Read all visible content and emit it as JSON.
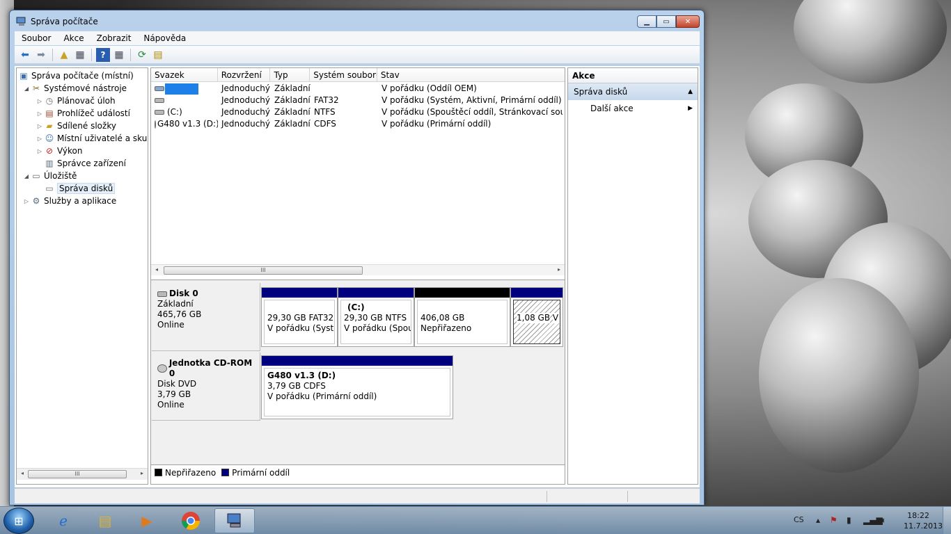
{
  "window": {
    "title": "Správa počítače"
  },
  "menu": [
    "Soubor",
    "Akce",
    "Zobrazit",
    "Nápověda"
  ],
  "tree": {
    "root": "Správa počítače (místní)",
    "system_tools": "Systémové nástroje",
    "items": [
      "Plánovač úloh",
      "Prohlížeč událostí",
      "Sdílené složky",
      "Místní uživatelé a skupiny",
      "Výkon",
      "Správce zařízení"
    ],
    "storage": "Úložiště",
    "disk_management": "Správa disků",
    "services": "Služby a aplikace"
  },
  "volumes": {
    "headers": [
      "Svazek",
      "Rozvržení",
      "Typ",
      "Systém souborů",
      "Stav"
    ],
    "rows": [
      [
        "",
        "Jednoduchý",
        "Základní",
        "",
        "V pořádku (Oddíl OEM)"
      ],
      [
        "",
        "Jednoduchý",
        "Základní",
        "FAT32",
        "V pořádku (Systém, Aktivní, Primární oddíl)"
      ],
      [
        "(C:)",
        "Jednoduchý",
        "Základní",
        "NTFS",
        "V pořádku (Spouštěcí oddíl, Stránkovací soubor, S"
      ],
      [
        "G480 v1.3 (D:)",
        "Jednoduchý",
        "Základní",
        "CDFS",
        "V pořádku (Primární oddíl)"
      ]
    ],
    "scroll_thumb": "III"
  },
  "disk0": {
    "name": "Disk 0",
    "type": "Základní",
    "size": "465,76 GB",
    "status": "Online",
    "partitions": [
      {
        "title": "",
        "size": "29,30 GB FAT32",
        "status": "V pořádku (Systém"
      },
      {
        "title": "(C:)",
        "size": "29,30 GB NTFS",
        "status": "V pořádku (Spouš"
      },
      {
        "title": "",
        "size": "406,08 GB",
        "status": "Nepřiřazeno"
      },
      {
        "title": "",
        "size": "1,08 GB",
        "status": "V pořádku ("
      }
    ]
  },
  "cdrom0": {
    "name": "Jednotka CD-ROM 0",
    "type": "Disk DVD",
    "size": "3,79 GB",
    "status": "Online",
    "partition": {
      "title": "G480 v1.3  (D:)",
      "size": "3,79 GB CDFS",
      "status": "V pořádku (Primární oddíl)"
    }
  },
  "legend": {
    "unallocated": "Nepřiřazeno",
    "primary": "Primární oddíl"
  },
  "actions": {
    "title": "Akce",
    "section": "Správa disků",
    "more": "Další akce"
  },
  "tree_scroll_thumb": "III",
  "taskbar": {
    "lang": "CS",
    "time": "18:22",
    "date": "11.7.2013"
  },
  "colors": {
    "primary": "#00007f",
    "unallocated": "#000000",
    "titlebar": "#b9d1ea"
  }
}
